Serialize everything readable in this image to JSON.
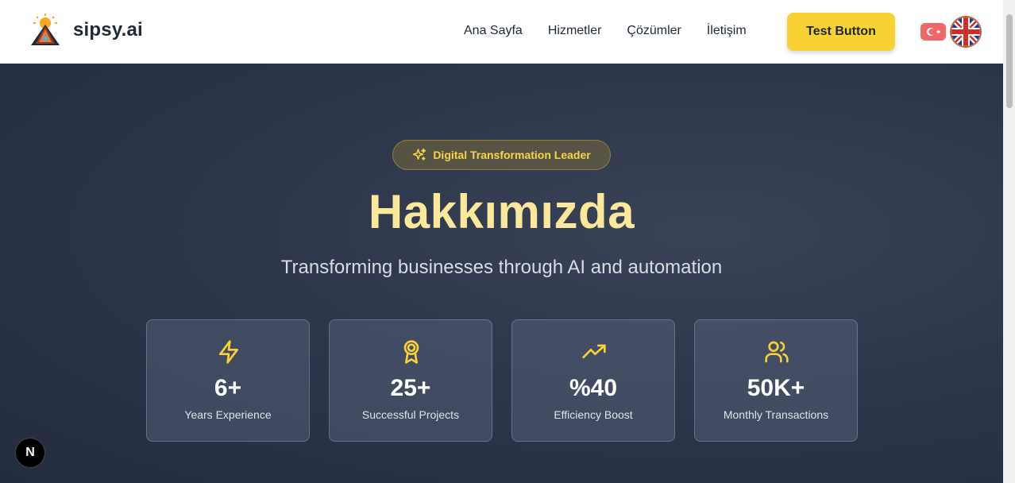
{
  "header": {
    "brand": "sipsy.ai",
    "nav": [
      "Ana Sayfa",
      "Hizmetler",
      "Çözümler",
      "İletişim"
    ],
    "cta_label": "Test Button"
  },
  "hero": {
    "badge": "Digital Transformation Leader",
    "title": "Hakkımızda",
    "subtitle": "Transforming businesses through AI and automation"
  },
  "stats": [
    {
      "value": "6+",
      "label": "Years Experience",
      "icon": "lightning-icon"
    },
    {
      "value": "25+",
      "label": "Successful Projects",
      "icon": "award-icon"
    },
    {
      "value": "%40",
      "label": "Efficiency Boost",
      "icon": "trending-up-icon"
    },
    {
      "value": "50K+",
      "label": "Monthly Transactions",
      "icon": "users-icon"
    }
  ],
  "dev_badge": "N",
  "colors": {
    "accent": "#f7d232",
    "title": "#fbe89a",
    "hero_bg": "#2d364b"
  }
}
